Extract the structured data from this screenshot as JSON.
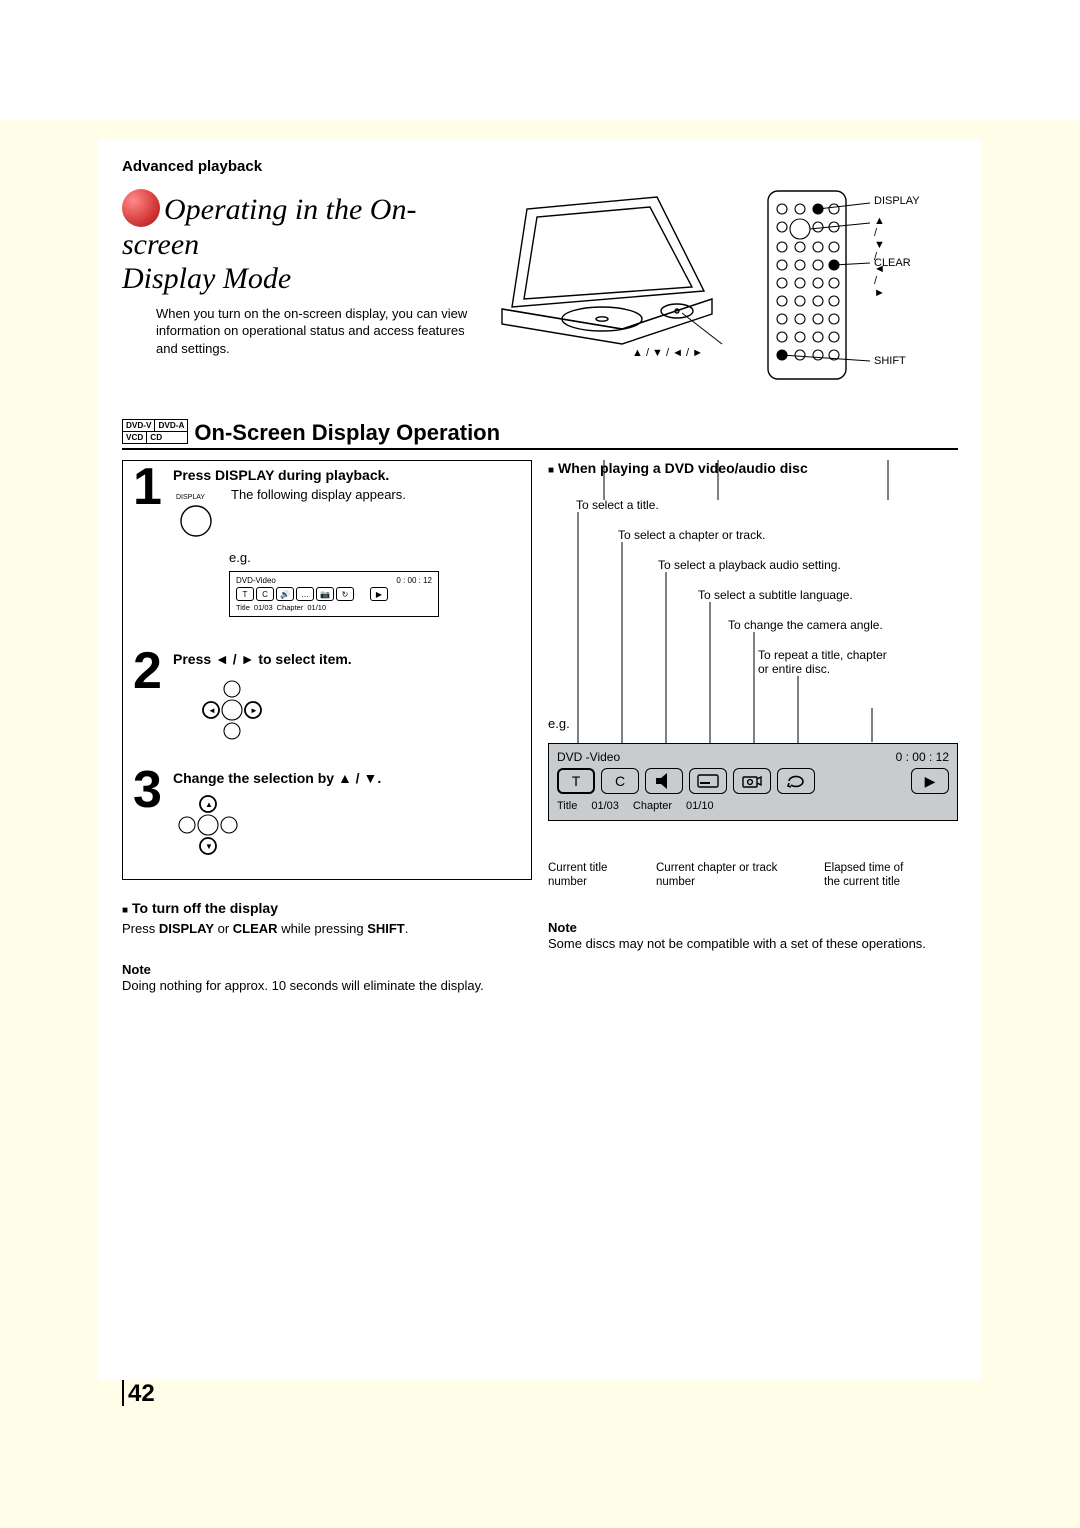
{
  "header": {
    "section": "Advanced playback"
  },
  "title": {
    "line1": "Operating in the On-screen",
    "line2": "Display Mode",
    "intro": "When you turn on the on-screen display, you can view information on operational status and access features and settings."
  },
  "device_labels": {
    "arrows_player": "▲ / ▼ / ◄ / ►",
    "display": "DISPLAY",
    "arrows_remote": "▲ / ▼ / ◄ / ►",
    "clear": "CLEAR",
    "shift": "SHIFT"
  },
  "section": {
    "badges": {
      "dvd_v": "DVD-V",
      "dvd_a": "DVD-A",
      "vcd": "VCD",
      "cd": "CD"
    },
    "title": "On-Screen Display Operation"
  },
  "steps": {
    "s1": {
      "num": "1",
      "head": "Press DISPLAY during playback.",
      "text": "The following display appears.",
      "btn_label": "DISPLAY",
      "eg": "e.g.",
      "osd": {
        "type": "DVD-Video",
        "time": "0 : 00 : 12",
        "t": "T",
        "c": "C",
        "title_lbl": "Title",
        "title_val": "01/03",
        "chapter_lbl": "Chapter",
        "chapter_val": "01/10"
      }
    },
    "s2": {
      "num": "2",
      "head_pre": "Press ",
      "head_arrows": "◄ / ►",
      "head_post": " to select item."
    },
    "s3": {
      "num": "3",
      "head_pre": "Change the selection by ",
      "head_arrows": "▲ / ▼",
      "head_post": "."
    }
  },
  "turn_off": {
    "head": "To turn off the display",
    "text_pre": "Press ",
    "display": "DISPLAY",
    "or": " or ",
    "clear": "CLEAR",
    "mid": " while pressing ",
    "shift": "SHIFT",
    "period": "."
  },
  "note_left": {
    "head": "Note",
    "text": "Doing nothing for approx. 10 seconds will eliminate the display."
  },
  "dvd": {
    "head": "When playing a DVD video/audio disc",
    "items": {
      "title": "To select a title.",
      "chapter": "To select a chapter or track.",
      "audio": "To select a playback audio setting.",
      "subtitle": "To select a subtitle language.",
      "angle": "To change the camera angle.",
      "repeat1": "To repeat a title, chapter",
      "repeat2": "or entire disc."
    },
    "eg": "e.g.",
    "osd": {
      "type": "DVD -Video",
      "time": "0 : 00 : 12",
      "t": "T",
      "c": "C",
      "title_lbl": "Title",
      "title_val": "01/03",
      "chapter_lbl": "Chapter",
      "chapter_val": "01/10"
    },
    "callouts": {
      "c1a": "Current title",
      "c1b": "number",
      "c2a": "Current chapter or track",
      "c2b": "number",
      "c3a": "Elapsed time of",
      "c3b": "the current title"
    }
  },
  "note_right": {
    "head": "Note",
    "text": "Some discs may not be compatible with a set of these operations."
  },
  "page_number": "42"
}
